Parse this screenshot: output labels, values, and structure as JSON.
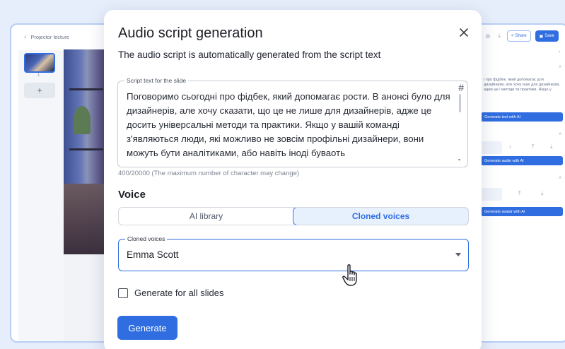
{
  "background_editor": {
    "project_title": "Projector lecture",
    "back_icon": "chevron-left-icon",
    "slide_number": "1",
    "add_slide_label": "+",
    "share_label": "Share",
    "save_label": "Save",
    "script_preview": "і про фідбек, який допомагає для дизайнерів, але хочу ише для дизайнерів, адже це і методи та практики. Якщо у",
    "generate_text_label": "Generate text with AI",
    "generate_audio_label": "Generate audio with AI",
    "generate_avatar_label": "Generate avatar with AI"
  },
  "modal": {
    "title": "Audio script generation",
    "subtitle": "The audio script is automatically generated from the script text",
    "script_field": {
      "label": "Script text for the slide",
      "value": "Поговоримо сьогодні про фідбек, який допомагає рости. В анонсі було для дизайнерів, але хочу сказати, що це не лише для дизайнерів, адже це досить універсальні методи та практики. Якщо у вашій команді з'являються люди, які можливо не зовсім профільні дизайнери, вони можуть бути аналітиками, або навіть іноді буваоть",
      "hash_symbol": "#",
      "char_counter": "400/20000 (The maximum number of character may change)"
    },
    "voice": {
      "heading": "Voice",
      "tabs": [
        {
          "label": "AI library",
          "active": false
        },
        {
          "label": "Cloned voices",
          "active": true
        }
      ],
      "select_label": "Cloned voices",
      "select_value": "Emma Scott"
    },
    "generate_all_label": "Generate for all slides",
    "generate_all_checked": false,
    "generate_button_label": "Generate"
  },
  "colors": {
    "accent": "#2f6de1",
    "page_background": "#e7eefb",
    "active_tab_background": "#e7f0fd"
  }
}
